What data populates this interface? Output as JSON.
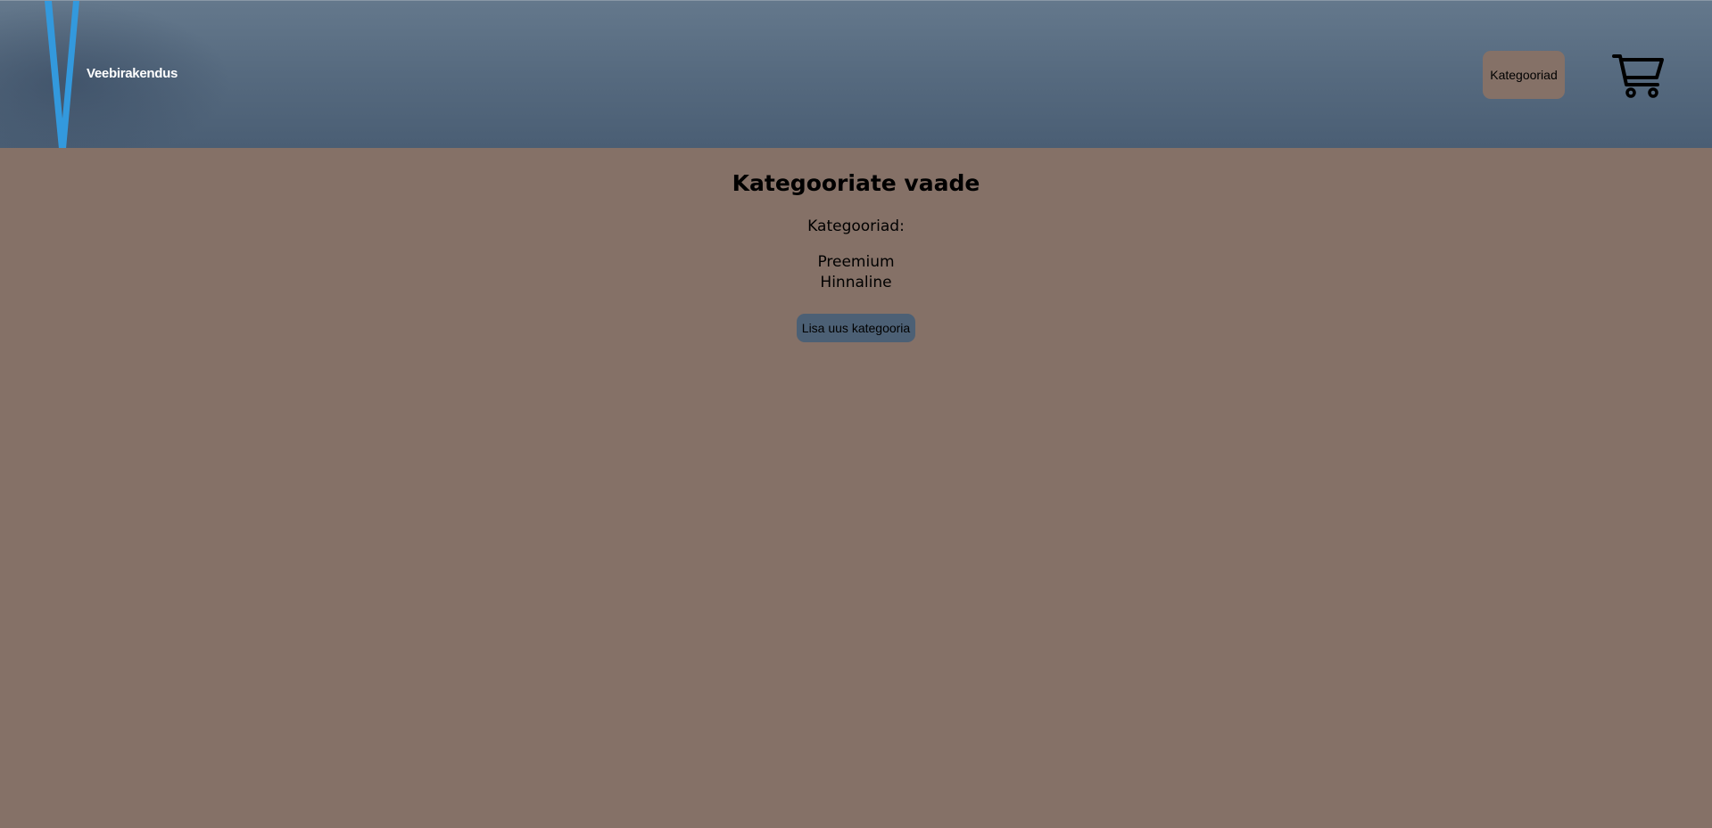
{
  "header": {
    "logo_text": "Veebirakendus",
    "nav_button_label": "Kategooriad",
    "cart_icon": "shopping-cart-icon"
  },
  "main": {
    "title": "Kategooriate vaade",
    "categories_label": "Kategooriad:",
    "categories": [
      "Preemium",
      "Hinnaline"
    ],
    "add_button_label": "Lisa uus kategooria"
  },
  "colors": {
    "page_background": "#857167",
    "header_background": "#566a7f",
    "logo_accent": "#3399dd",
    "add_button_background": "#4c6075"
  }
}
